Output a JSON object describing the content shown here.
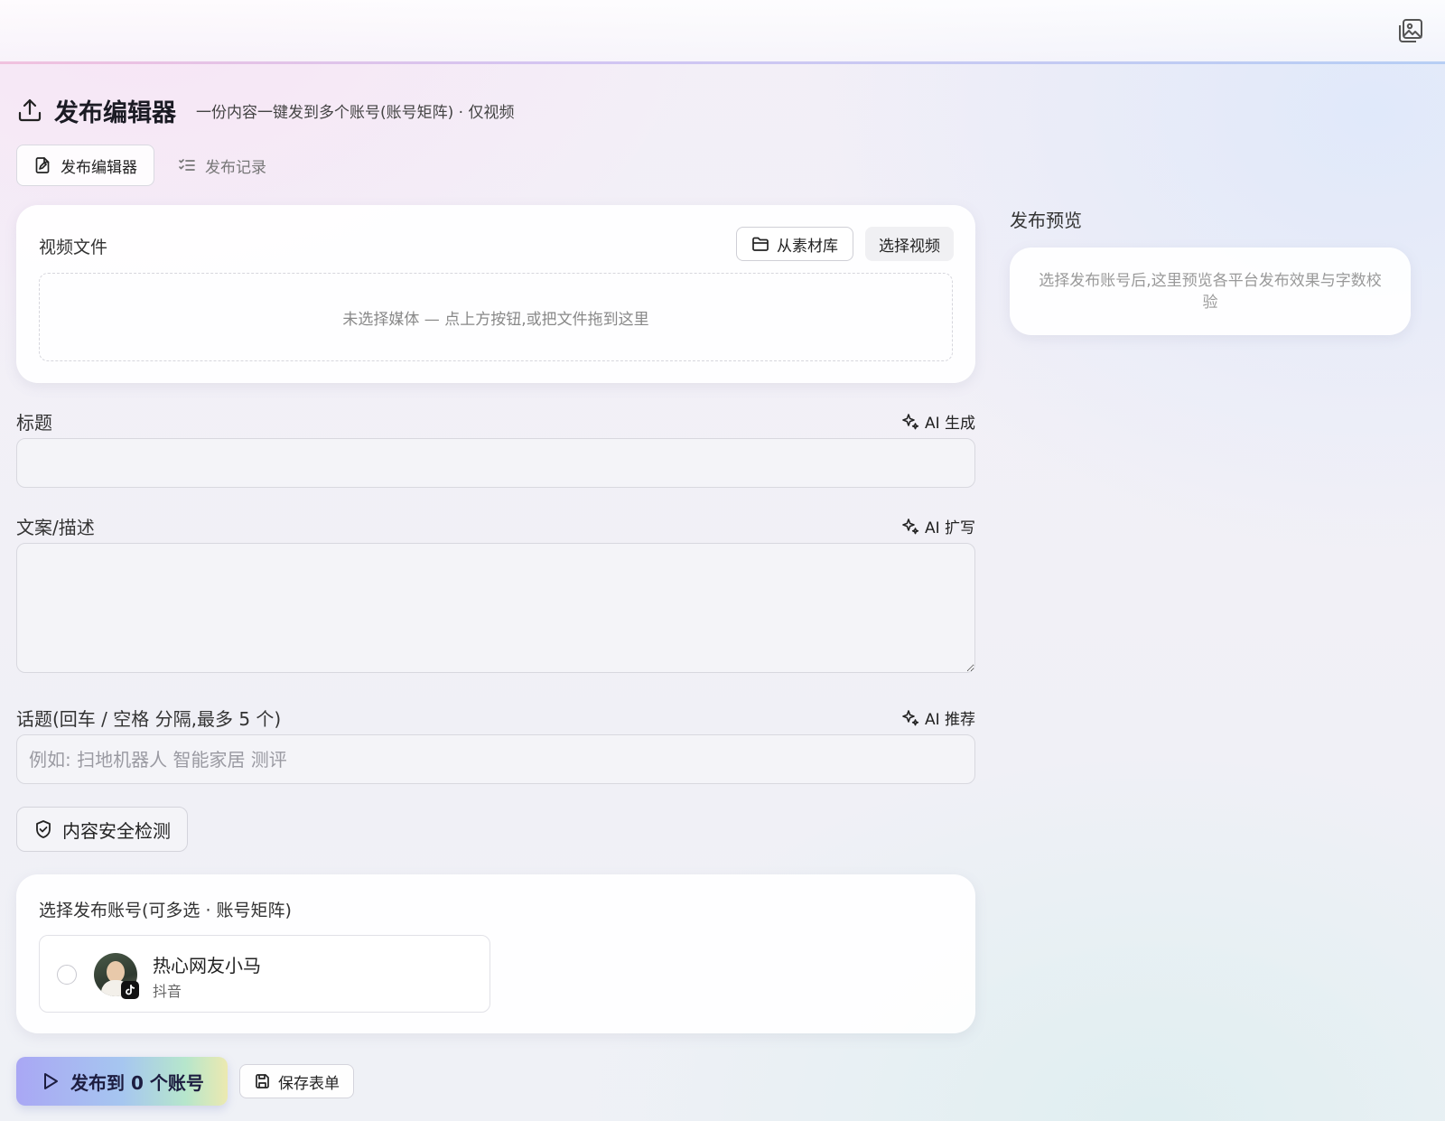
{
  "header": {
    "title": "发布编辑器",
    "subtitle": "一份内容一键发到多个账号(账号矩阵) · 仅视频"
  },
  "tabs": [
    {
      "label": "发布编辑器",
      "active": true
    },
    {
      "label": "发布记录",
      "active": false
    }
  ],
  "media": {
    "label": "视频文件",
    "library_button": "从素材库",
    "select_button": "选择视频",
    "dropzone_text": "未选择媒体 — 点上方按钮,或把文件拖到这里"
  },
  "title_field": {
    "label": "标题",
    "ai_action": "AI 生成",
    "value": ""
  },
  "description_field": {
    "label": "文案/描述",
    "ai_action": "AI 扩写",
    "value": ""
  },
  "topics_field": {
    "label": "话题(回车 / 空格 分隔,最多 5 个)",
    "ai_action": "AI 推荐",
    "placeholder": "例如: 扫地机器人 智能家居 测评",
    "value": ""
  },
  "safety_button": "内容安全检测",
  "accounts": {
    "label": "选择发布账号(可多选 · 账号矩阵)",
    "items": [
      {
        "name": "热心网友小马",
        "platform": "抖音",
        "selected": false
      }
    ]
  },
  "actions": {
    "publish_button": "发布到 0 个账号",
    "save_button": "保存表单"
  },
  "preview": {
    "title": "发布预览",
    "empty_text": "选择发布账号后,这里预览各平台发布效果与字数校验"
  },
  "colors": {
    "publish_gradient": [
      "#a9a7f4",
      "#a6c6f0",
      "#b6e6cc",
      "#ece9b0"
    ],
    "topbar_accent": [
      "#efb6d8",
      "#c9b9f0",
      "#a9c6f2"
    ]
  }
}
